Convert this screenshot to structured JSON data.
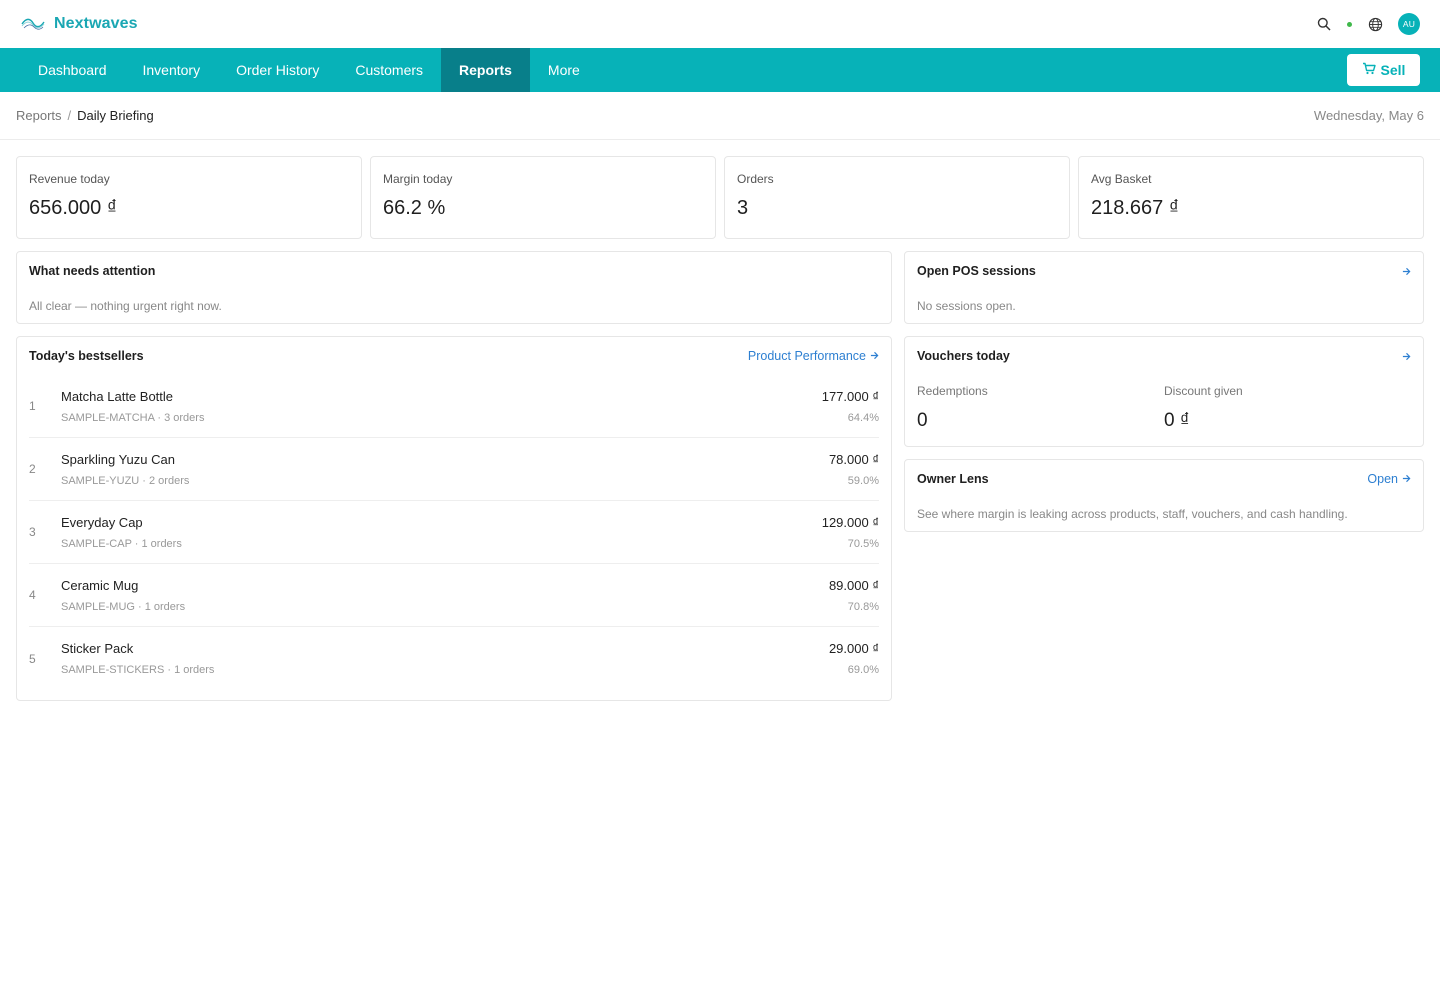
{
  "brand": {
    "name": "Nextwaves",
    "logo_icon": "wave-logo-icon"
  },
  "topbar": {
    "icons": [
      "search-icon",
      "status-dot",
      "globe-icon"
    ],
    "avatar_initials": "AU",
    "status_color": "#3fb84a"
  },
  "nav": {
    "items": [
      {
        "label": "Dashboard"
      },
      {
        "label": "Inventory"
      },
      {
        "label": "Order History"
      },
      {
        "label": "Customers"
      },
      {
        "label": "Reports"
      },
      {
        "label": "More"
      }
    ],
    "active": "Reports",
    "sell_label": "Sell",
    "sell_icon": "cart-icon",
    "accent_color": "#07b2b8",
    "active_color": "#087f8a"
  },
  "breadcrumb": {
    "parent": "Reports",
    "separator": "/",
    "current": "Daily Briefing"
  },
  "date": "Wednesday, May 6",
  "kpis": [
    {
      "label": "Revenue today",
      "value": "656.000 ₫"
    },
    {
      "label": "Margin today",
      "value": "66.2 %"
    },
    {
      "label": "Orders",
      "value": "3"
    },
    {
      "label": "Avg Basket",
      "value": "218.667 ₫"
    }
  ],
  "attention": {
    "title": "What needs attention",
    "body": "All clear — nothing urgent right now."
  },
  "pos_sessions": {
    "title": "Open POS sessions",
    "body": "No sessions open.",
    "link_icon": "arrow-right-icon"
  },
  "bestsellers": {
    "title": "Today's bestsellers",
    "link_label": "Product Performance",
    "items": [
      {
        "rank": "1",
        "name": "Matcha Latte Bottle",
        "meta": "SAMPLE-MATCHA · 3 orders",
        "amount": "177.000 ₫",
        "margin": "64.4%"
      },
      {
        "rank": "2",
        "name": "Sparkling Yuzu Can",
        "meta": "SAMPLE-YUZU · 2 orders",
        "amount": "78.000 ₫",
        "margin": "59.0%"
      },
      {
        "rank": "3",
        "name": "Everyday Cap",
        "meta": "SAMPLE-CAP · 1 orders",
        "amount": "129.000 ₫",
        "margin": "70.5%"
      },
      {
        "rank": "4",
        "name": "Ceramic Mug",
        "meta": "SAMPLE-MUG · 1 orders",
        "amount": "89.000 ₫",
        "margin": "70.8%"
      },
      {
        "rank": "5",
        "name": "Sticker Pack",
        "meta": "SAMPLE-STICKERS · 1 orders",
        "amount": "29.000 ₫",
        "margin": "69.0%"
      }
    ]
  },
  "vouchers": {
    "title": "Vouchers today",
    "redemptions_label": "Redemptions",
    "redemptions_value": "0",
    "discount_label": "Discount given",
    "discount_value": "0 ₫"
  },
  "owner_lens": {
    "title": "Owner Lens",
    "link_label": "Open",
    "body": "See where margin is leaking across products, staff, vouchers, and cash handling."
  }
}
